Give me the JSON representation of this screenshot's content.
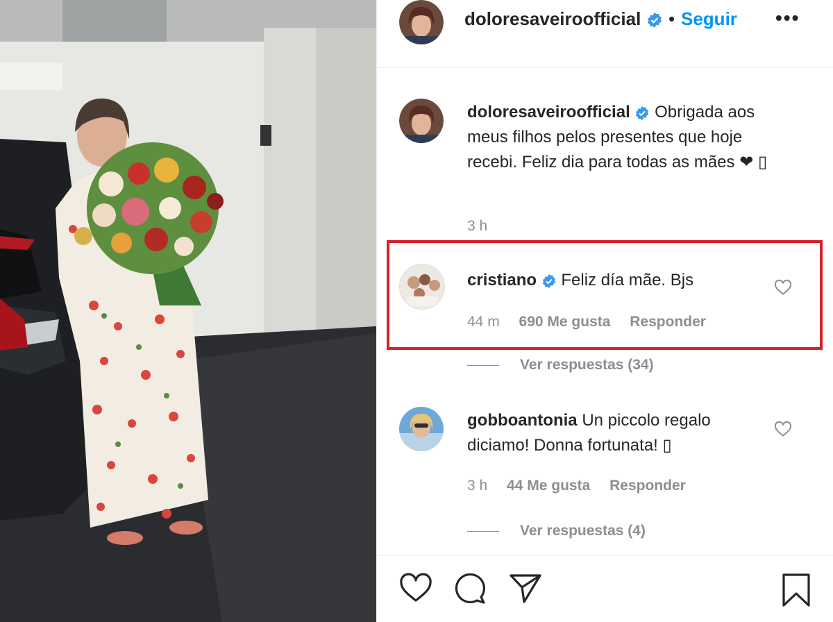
{
  "post": {
    "author": "doloresaveiroofficial",
    "separator": "•",
    "follow_label": "Seguir",
    "more_label": "•••",
    "caption": {
      "username": "doloresaveiroofficial",
      "text": "Obrigada aos meus filhos pelos presentes que hoje recebi. Feliz dia para todas as mães ❤ ▯",
      "time": "3 h"
    }
  },
  "comments": [
    {
      "username": "cristiano",
      "verified": true,
      "text": "Feliz día mãe. Bjs",
      "time": "44 m",
      "likes": "690 Me gusta",
      "reply_label": "Responder",
      "view_replies": "Ver respuestas (34)"
    },
    {
      "username": "gobboantonia",
      "verified": false,
      "text": "Un piccolo regalo diciamo! Donna fortunata! ▯",
      "time": "3 h",
      "likes": "44 Me gusta",
      "reply_label": "Responder",
      "view_replies": "Ver respuestas (4)"
    }
  ],
  "icons": {
    "verified": "verified-badge-icon",
    "like": "heart-icon",
    "comment": "comment-bubble-icon",
    "share": "paper-plane-icon",
    "save": "bookmark-icon"
  },
  "colors": {
    "link_blue": "#0095f6",
    "verified_blue": "#3897f0",
    "muted_text": "#8e8e8e",
    "highlight_red": "#d6202b"
  }
}
